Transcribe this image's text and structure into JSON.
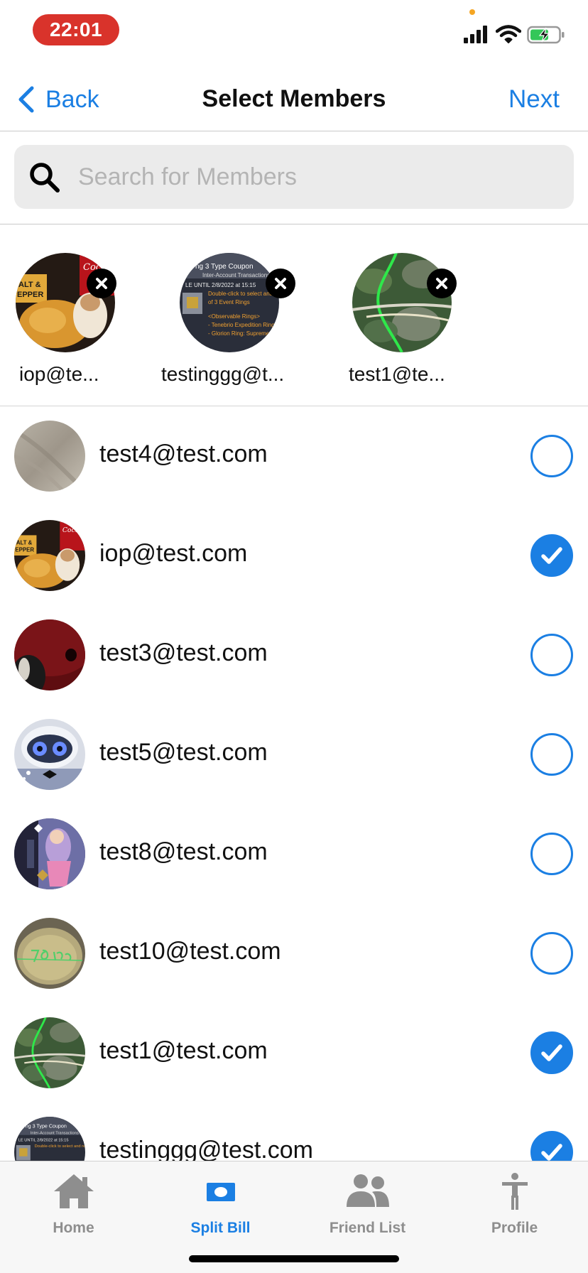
{
  "status_bar": {
    "time": "22:01"
  },
  "nav": {
    "back_label": "Back",
    "title": "Select Members",
    "next_label": "Next"
  },
  "search": {
    "placeholder": "Search for Members",
    "value": ""
  },
  "selected": [
    {
      "label": "iop@te...",
      "avatar": "food-photo"
    },
    {
      "label": "testinggg@t...",
      "avatar": "coupon-photo"
    },
    {
      "label": "test1@te...",
      "avatar": "map-photo"
    }
  ],
  "members": [
    {
      "email": "test4@test.com",
      "selected": false,
      "avatar": "blurred-photo"
    },
    {
      "email": "iop@test.com",
      "selected": true,
      "avatar": "food-photo"
    },
    {
      "email": "test3@test.com",
      "selected": false,
      "avatar": "dark-red-photo"
    },
    {
      "email": "test5@test.com",
      "selected": false,
      "avatar": "robot-photo"
    },
    {
      "email": "test8@test.com",
      "selected": false,
      "avatar": "game-art-photo"
    },
    {
      "email": "test10@test.com",
      "selected": false,
      "avatar": "handwriting-photo"
    },
    {
      "email": "test1@test.com",
      "selected": true,
      "avatar": "map-photo"
    },
    {
      "email": "testinggg@test.com",
      "selected": true,
      "avatar": "coupon-photo"
    }
  ],
  "tabs": [
    {
      "label": "Home",
      "icon": "home-icon",
      "active": false
    },
    {
      "label": "Split Bill",
      "icon": "bill-icon",
      "active": true
    },
    {
      "label": "Friend List",
      "icon": "people-icon",
      "active": false
    },
    {
      "label": "Profile",
      "icon": "person-icon",
      "active": false
    }
  ],
  "colors": {
    "accent": "#1b7fe3",
    "time_pill": "#d9332b",
    "inactive_tab": "#8e8e8e"
  }
}
